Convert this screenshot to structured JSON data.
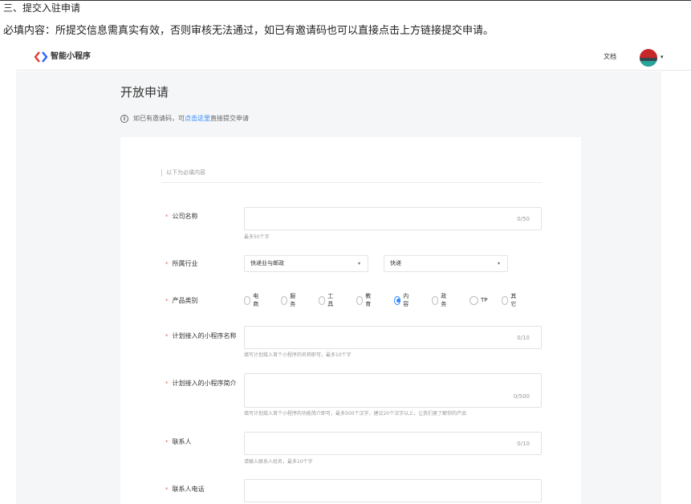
{
  "doc": {
    "heading": "三、提交入驻申请",
    "description": "必填内容：所提交信息需真实有效，否则审核无法通过，如已有邀请码也可以直接点击上方链接提交申请。"
  },
  "header": {
    "brand": "智能小程序",
    "docs_link": "文档",
    "caret": "▾"
  },
  "page": {
    "title": "开放申请",
    "tip_prefix": "如已有邀请码，可",
    "tip_link": "点击这里",
    "tip_suffix": "直接提交申请",
    "info_icon": "i"
  },
  "form": {
    "section_label": "以下为必填内容",
    "required_mark": "*",
    "company": {
      "label": "公司名称",
      "value": "",
      "counter": "0/50",
      "hint": "最多50个字"
    },
    "industry": {
      "label": "所属行业",
      "primary": "快递业与邮政",
      "secondary": "快递",
      "caret": "▾"
    },
    "category": {
      "label": "产品类别",
      "options": [
        "电商",
        "服务",
        "工具",
        "教育",
        "内容",
        "政务",
        "TP",
        "其它"
      ],
      "selected": "内容"
    },
    "app_name": {
      "label": "计划接入的小程序名称",
      "value": "",
      "counter": "0/10",
      "hint": "填写计划接入首个小程序的名称即可，最多10个字"
    },
    "app_intro": {
      "label": "计划接入的小程序简介",
      "value": "",
      "counter": "0/500",
      "hint": "填写计划接入首个小程序的功能简介即可，最多500个汉字，建议20个汉字以上，让我们更了解你的产品"
    },
    "contact": {
      "label": "联系人",
      "value": "",
      "counter": "0/10",
      "hint": "请输入联系人姓名，最多10个字"
    },
    "contact_phone": {
      "label": "联系人电话",
      "value": ""
    }
  },
  "colors": {
    "accent": "#3388ff",
    "required": "#f25a5a",
    "page_bg": "#f5f6f7"
  }
}
